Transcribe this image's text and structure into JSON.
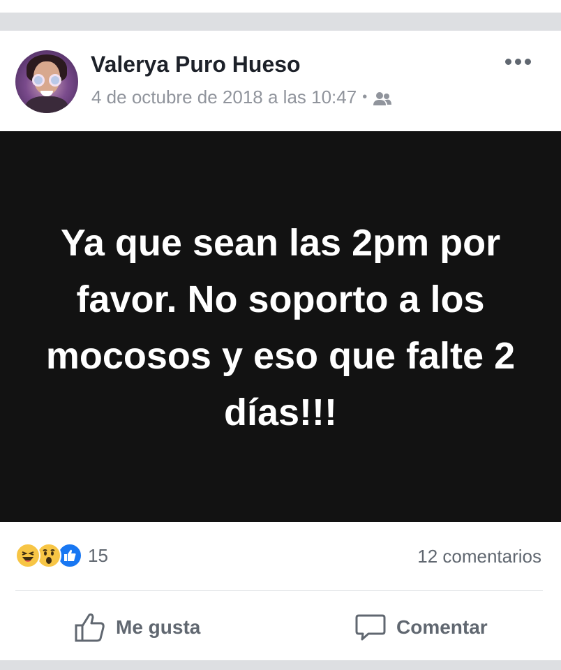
{
  "post": {
    "author": "Valerya Puro Hueso",
    "timestamp": "4 de octubre de 2018 a las 10:47",
    "separator": "•",
    "audience_icon": "friends-icon",
    "image_text": "Ya que sean las 2pm por favor. No soporto a los mocosos y eso que falte 2 días!!!",
    "reaction_icons": [
      "haha-reaction-icon",
      "wow-reaction-icon",
      "like-reaction-icon"
    ],
    "reaction_count": "15",
    "comment_count": "12 comentarios"
  },
  "actions": {
    "like_label": "Me gusta",
    "comment_label": "Comentar"
  },
  "colors": {
    "name": "#1d2129",
    "meta": "#90949c",
    "image_bg": "#121212",
    "action": "#606770",
    "like_reaction": "#1877f2",
    "emoji": "#f7c545"
  }
}
